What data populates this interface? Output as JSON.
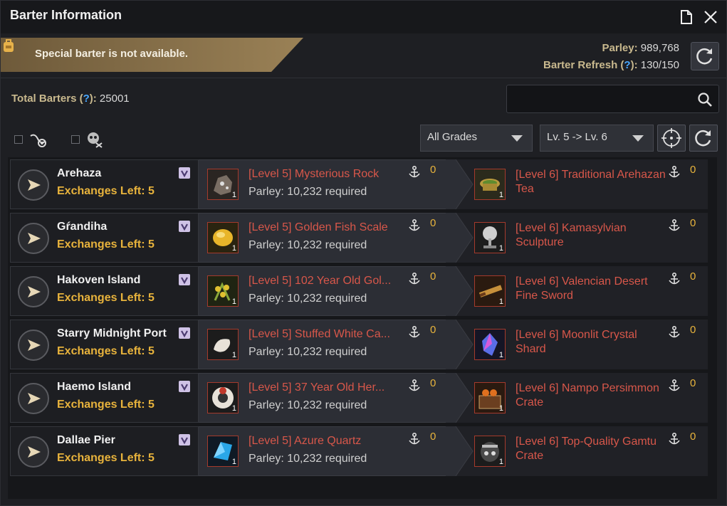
{
  "window": {
    "title": "Barter Information"
  },
  "banner": {
    "text": "Special barter is not available."
  },
  "stats": {
    "parley_label": "Parley:",
    "parley_value": "989,768",
    "refresh_label": "Barter Refresh (",
    "refresh_q": "?",
    "refresh_close": "):",
    "refresh_value": "130/150",
    "total_label": "Total Barters (",
    "total_q": "?",
    "total_close": "):",
    "total_value": "25001"
  },
  "search": {
    "placeholder": ""
  },
  "filters": {
    "grade_select": "All Grades",
    "level_select": "Lv. 5 -> Lv. 6"
  },
  "colors": {
    "accent_gold": "#e8b33c",
    "item_red": "#d8574a",
    "question_blue": "#4aa8ff"
  },
  "rows": [
    {
      "npc": "Arehaza",
      "ex_label": "Exchanges Left:",
      "ex_value": "5",
      "give": "[Level 5] Mysterious Rock",
      "parley": "Parley: 10,232 required",
      "give_count": "1",
      "give_anchor": "0",
      "get": "[Level 6] Traditional Arehazan Tea",
      "get_count": "1",
      "get_anchor": "0",
      "give_icon": "rock-icon",
      "get_icon": "tea-icon"
    },
    {
      "npc": "Gŕandiha",
      "ex_label": "Exchanges Left:",
      "ex_value": "5",
      "give": "[Level 5] Golden Fish Scale",
      "parley": "Parley: 10,232 required",
      "give_count": "1",
      "give_anchor": "0",
      "get": "[Level 6] Kamasylvian Sculpture",
      "get_count": "1",
      "get_anchor": "0",
      "give_icon": "fish-scale-icon",
      "get_icon": "sculpture-icon"
    },
    {
      "npc": "Hakoven Island",
      "ex_label": "Exchanges Left:",
      "ex_value": "5",
      "give": "[Level 5] 102 Year Old Gol...",
      "parley": "Parley: 10,232 required",
      "give_count": "1",
      "give_anchor": "0",
      "get": "[Level 6] Valencian Desert Fine Sword",
      "get_count": "1",
      "get_anchor": "0",
      "give_icon": "herb-icon",
      "get_icon": "sword-icon"
    },
    {
      "npc": "Starry Midnight Port",
      "ex_label": "Exchanges Left:",
      "ex_value": "5",
      "give": "[Level 5] Stuffed White Ca...",
      "parley": "Parley: 10,232 required",
      "give_count": "1",
      "give_anchor": "0",
      "get": "[Level 6] Moonlit Crystal Shard",
      "get_count": "1",
      "get_anchor": "0",
      "give_icon": "larva-icon",
      "get_icon": "crystal-icon"
    },
    {
      "npc": "Haemo Island",
      "ex_label": "Exchanges Left:",
      "ex_value": "5",
      "give": "[Level 5] 37 Year Old Her...",
      "parley": "Parley: 10,232 required",
      "give_count": "1",
      "give_anchor": "0",
      "get": "[Level 6] Nampo Persimmon Crate",
      "get_count": "1",
      "get_anchor": "0",
      "give_icon": "herb-box-icon",
      "get_icon": "crate-icon"
    },
    {
      "npc": "Dallae Pier",
      "ex_label": "Exchanges Left:",
      "ex_value": "5",
      "give": "[Level 5] Azure Quartz",
      "parley": "Parley: 10,232 required",
      "give_count": "1",
      "give_anchor": "0",
      "get": "[Level 6] Top-Quality Gamtu Crate",
      "get_count": "1",
      "get_anchor": "0",
      "give_icon": "quartz-icon",
      "get_icon": "gamtu-crate-icon"
    }
  ]
}
